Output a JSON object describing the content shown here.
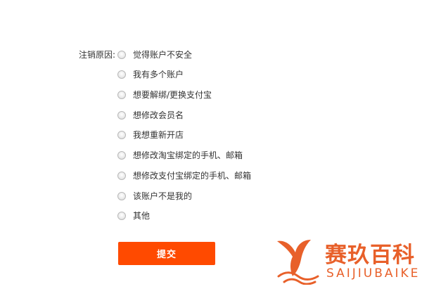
{
  "form": {
    "label": "注销原因:",
    "options": [
      {
        "label": "觉得账户不安全",
        "checked": false
      },
      {
        "label": "我有多个账户",
        "checked": false
      },
      {
        "label": "想要解绑/更换支付宝",
        "checked": false
      },
      {
        "label": "想修改会员名",
        "checked": false
      },
      {
        "label": "我想重新开店",
        "checked": false
      },
      {
        "label": "想修改淘宝绑定的手机、邮箱",
        "checked": false
      },
      {
        "label": "想修改支付宝绑定的手机、邮箱",
        "checked": false
      },
      {
        "label": "该账户不是我的",
        "checked": false
      },
      {
        "label": "其他",
        "checked": false
      }
    ],
    "submit_label": "提交"
  },
  "watermark": {
    "brand_cn": "赛玖百科",
    "brand_en": "SAIJIUBAIKE"
  },
  "colors": {
    "accent": "#ff4a00",
    "watermark": "#e8602a",
    "text": "#333333"
  }
}
